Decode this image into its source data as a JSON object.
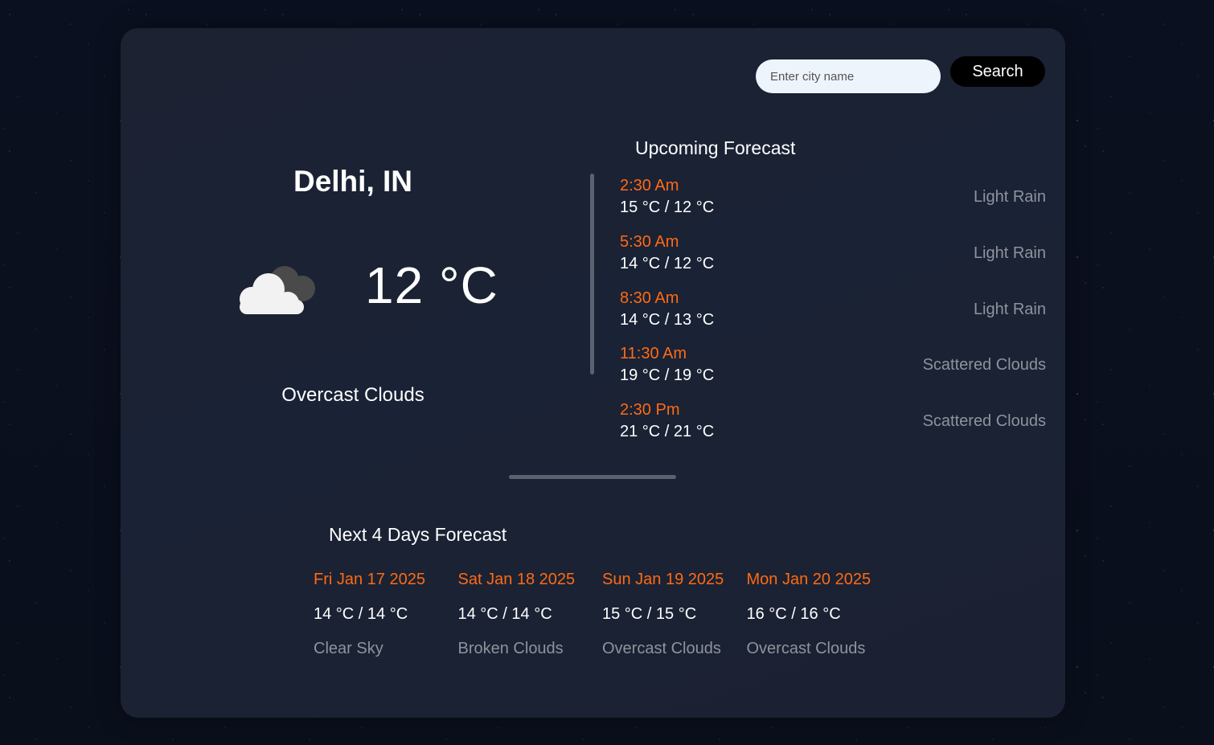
{
  "search": {
    "placeholder": "Enter city name",
    "button_label": "Search"
  },
  "current": {
    "city": "Delhi, IN",
    "temperature": "12 °C",
    "condition": "Overcast Clouds",
    "icon": "cloud-icon"
  },
  "upcoming": {
    "title": "Upcoming Forecast",
    "items": [
      {
        "time": "2:30 Am",
        "temps": "15 °C / 12 °C",
        "desc": "Light Rain"
      },
      {
        "time": "5:30 Am",
        "temps": "14 °C / 12 °C",
        "desc": "Light Rain"
      },
      {
        "time": "8:30 Am",
        "temps": "14 °C / 13 °C",
        "desc": "Light Rain"
      },
      {
        "time": "11:30 Am",
        "temps": "19 °C / 19 °C",
        "desc": "Scattered Clouds"
      },
      {
        "time": "2:30 Pm",
        "temps": "21 °C / 21 °C",
        "desc": "Scattered Clouds"
      }
    ]
  },
  "days": {
    "title": "Next 4 Days Forecast",
    "items": [
      {
        "date": "Fri Jan 17 2025",
        "temps": "14 °C / 14 °C",
        "desc": "Clear Sky"
      },
      {
        "date": "Sat Jan 18 2025",
        "temps": "14 °C / 14 °C",
        "desc": "Broken Clouds"
      },
      {
        "date": "Sun Jan 19 2025",
        "temps": "15 °C / 15 °C",
        "desc": "Overcast Clouds"
      },
      {
        "date": "Mon Jan 20 2025",
        "temps": "16 °C / 16 °C",
        "desc": "Overcast Clouds"
      }
    ]
  },
  "colors": {
    "accent": "#ff6a13",
    "muted": "#8e939c",
    "card": "#1b2233",
    "background": "#0a0e1a"
  }
}
